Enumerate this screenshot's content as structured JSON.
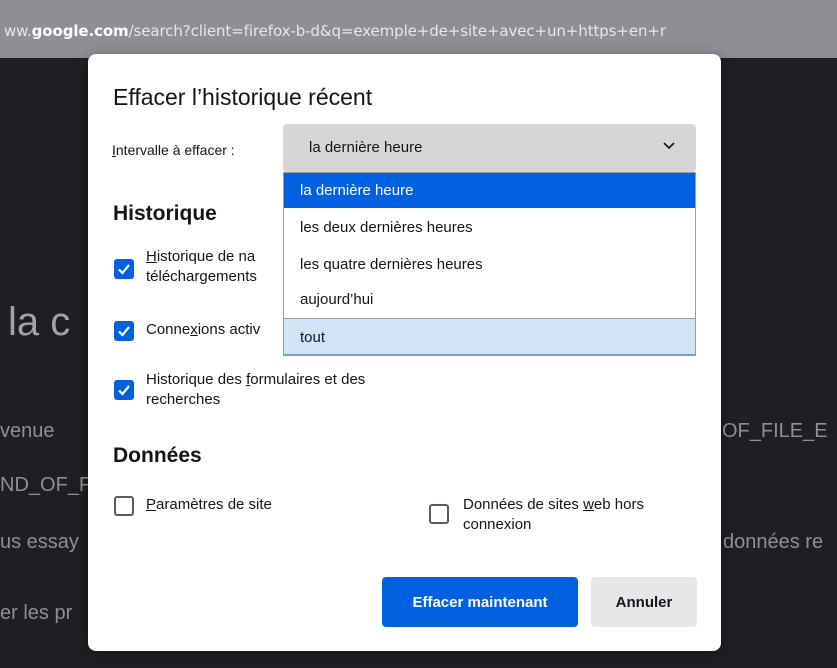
{
  "browser": {
    "url_prefix": "ww.",
    "url_domain": "google.com",
    "url_rest": "/search?client=firefox-b-d&q=exemple+de+site+avec+un+https+en+r"
  },
  "background_page": {
    "heading": "la c",
    "line_venue": "venue",
    "line_eof_right": "OF_FILE_E",
    "line_nd": "ND_OF_F",
    "line_essay": "us essay",
    "line_donnees_right": "données re",
    "line_pr": "er les pr"
  },
  "dialog": {
    "title": "Effacer l’historique récent",
    "range_label_prefix": "I",
    "range_label_rest": "ntervalle à effacer :",
    "range_value": "la dernière heure",
    "history_section": "Historique",
    "history_items": [
      {
        "label_a": "",
        "label_u": "H",
        "label_b": "istorique de na",
        "label_line2": "téléchargements",
        "checked": true
      },
      {
        "label_a": "Conne",
        "label_u": "x",
        "label_b": "ions activ",
        "checked": true
      },
      {
        "label_a": "Historique des ",
        "label_u": "f",
        "label_b": "ormulaires et des",
        "label_line2": "recherches",
        "checked": true
      }
    ],
    "data_section": "Données",
    "data_items": [
      {
        "label_a": "",
        "label_u": "P",
        "label_b": "aramètres de site",
        "checked": false
      },
      {
        "label_a": "Données de sites ",
        "label_u": "w",
        "label_b": "eb hors",
        "label_line2": "connexion",
        "checked": false
      }
    ],
    "clear_button": "Effacer maintenant",
    "cancel_button": "Annuler"
  },
  "dropdown": {
    "options": [
      "la dernière heure",
      "les deux dernières heures",
      "les quatre dernières heures",
      "aujourd’hui",
      "tout"
    ],
    "selected": "la dernière heure",
    "hovered": "tout"
  },
  "colors": {
    "accent": "#0061e0",
    "hover_option": "#d2e3f5",
    "backdrop": "#1f1e22"
  }
}
